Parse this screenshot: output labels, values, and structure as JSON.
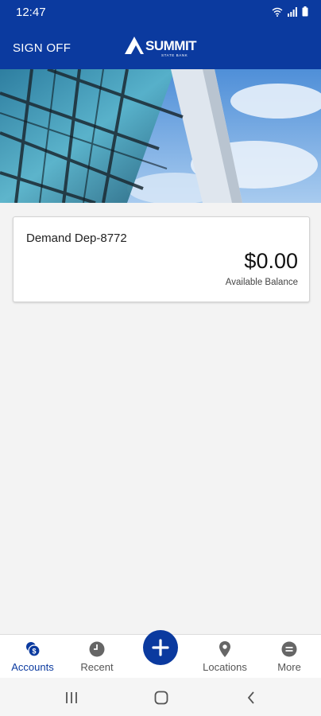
{
  "status_bar": {
    "time": "12:47",
    "icons": [
      "wifi-icon",
      "signal-icon",
      "battery-icon"
    ]
  },
  "header": {
    "sign_off_label": "SIGN OFF",
    "logo_name": "SUMMIT",
    "logo_sub": "STATE BANK"
  },
  "account": {
    "name": "Demand Dep-8772",
    "balance": "$0.00",
    "balance_label": "Available Balance"
  },
  "bottom_nav": {
    "items": [
      {
        "label": "Accounts",
        "icon": "accounts-icon",
        "active": true
      },
      {
        "label": "Recent",
        "icon": "clock-icon",
        "active": false
      },
      {
        "label": "",
        "icon": "plus-icon",
        "active": false
      },
      {
        "label": "Locations",
        "icon": "location-pin-icon",
        "active": false
      },
      {
        "label": "More",
        "icon": "more-icon",
        "active": false
      }
    ]
  },
  "system_nav": [
    "recents-icon",
    "home-icon",
    "back-icon"
  ],
  "colors": {
    "brand": "#0b3a9f",
    "background": "#f3f3f3"
  }
}
